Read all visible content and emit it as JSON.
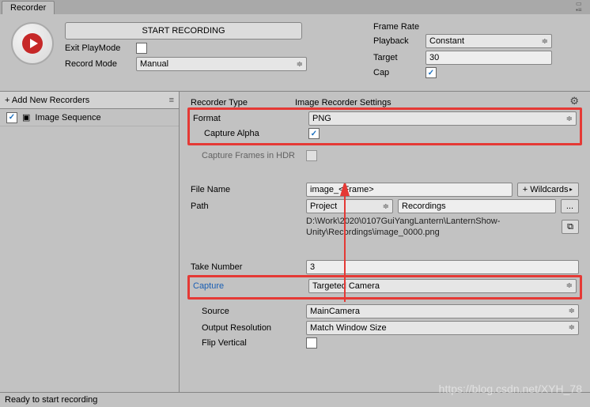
{
  "tab": {
    "title": "Recorder"
  },
  "top": {
    "start_label": "START RECORDING",
    "exit_label": "Exit PlayMode",
    "exit_checked": false,
    "mode_label": "Record Mode",
    "mode_value": "Manual"
  },
  "frame_rate": {
    "title": "Frame Rate",
    "playback_label": "Playback",
    "playback_value": "Constant",
    "target_label": "Target",
    "target_value": "30",
    "cap_label": "Cap",
    "cap_checked": true
  },
  "sidebar": {
    "add_label": "+ Add New Recorders",
    "items": [
      {
        "label": "Image Sequence",
        "checked": true
      }
    ]
  },
  "recorder": {
    "title_label": "Recorder Type",
    "settings_label": "Image Recorder Settings",
    "format_label": "Format",
    "format_value": "PNG",
    "alpha_label": "Capture Alpha",
    "alpha_checked": true,
    "hdr_label": "Capture Frames in HDR",
    "hdr_checked": false,
    "filename_label": "File Name",
    "filename_value": "image_<Frame>",
    "wildcards_label": "+ Wildcards ",
    "path_label": "Path",
    "path_dropdown": "Project",
    "path_value": "Recordings",
    "ellipsis": "...",
    "full_path": "D:\\Work\\2020\\0107GuiYangLantern\\LanternShow-Unity\\Recordings\\image_0000.png",
    "take_label": "Take Number",
    "take_value": "3",
    "capture_label": "Capture",
    "capture_value": "Targeted Camera",
    "source_label": "Source",
    "source_value": "MainCamera",
    "res_label": "Output Resolution",
    "res_value": "Match Window Size",
    "flip_label": "Flip Vertical",
    "flip_checked": false
  },
  "footer": {
    "status": "Ready to start recording"
  },
  "watermark": "https://blog.csdn.net/XYH_78"
}
